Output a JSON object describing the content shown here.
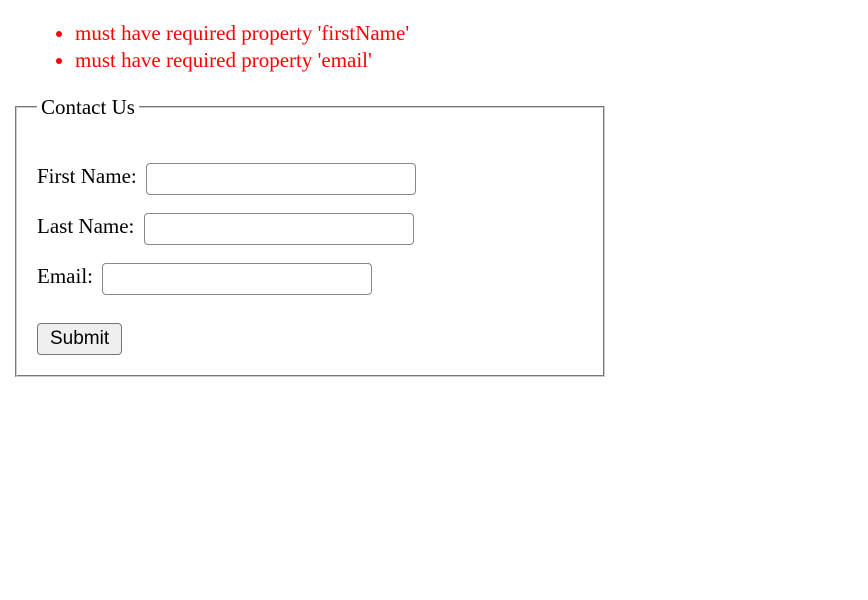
{
  "errors": [
    "must have required property 'firstName'",
    "must have required property 'email'"
  ],
  "form": {
    "legend": "Contact Us",
    "fields": {
      "firstName": {
        "label": "First Name:",
        "value": ""
      },
      "lastName": {
        "label": "Last Name:",
        "value": ""
      },
      "email": {
        "label": "Email:",
        "value": ""
      }
    },
    "submit_label": "Submit"
  }
}
